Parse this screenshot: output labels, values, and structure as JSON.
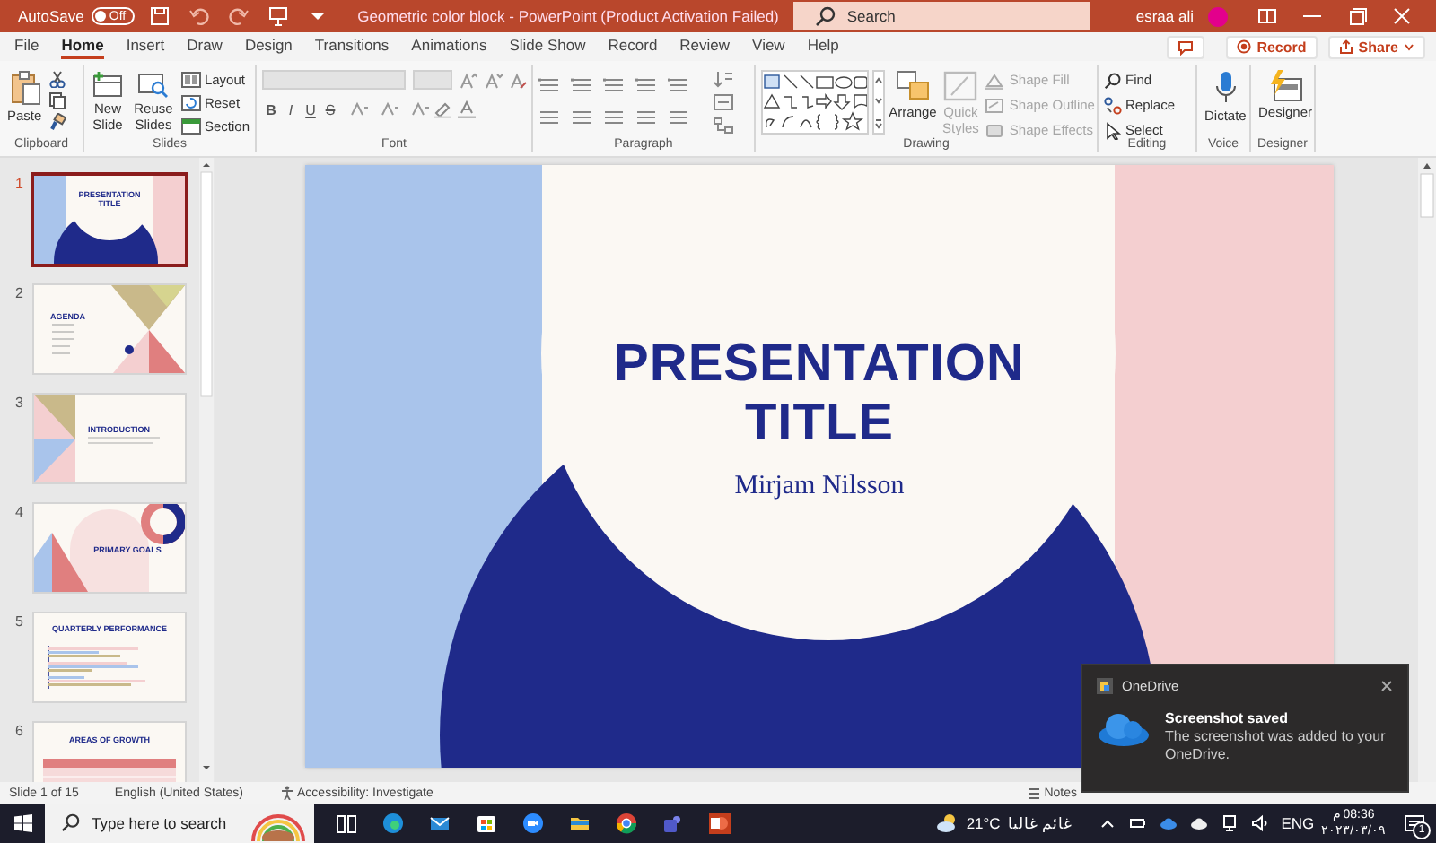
{
  "title_bar": {
    "autosave_label": "AutoSave",
    "autosave_toggle": {
      "label": "Off",
      "on": false
    },
    "document_title": "Geometric color block  -  PowerPoint (Product Activation Failed)",
    "search": {
      "placeholder": "Search"
    },
    "user_name": "esraa ali"
  },
  "tabs": [
    {
      "label": "File",
      "selected": false
    },
    {
      "label": "Home",
      "selected": true
    },
    {
      "label": "Insert",
      "selected": false
    },
    {
      "label": "Draw",
      "selected": false
    },
    {
      "label": "Design",
      "selected": false
    },
    {
      "label": "Transitions",
      "selected": false
    },
    {
      "label": "Animations",
      "selected": false
    },
    {
      "label": "Slide Show",
      "selected": false
    },
    {
      "label": "Record",
      "selected": false
    },
    {
      "label": "Review",
      "selected": false
    },
    {
      "label": "View",
      "selected": false
    },
    {
      "label": "Help",
      "selected": false
    }
  ],
  "tab_bar_actions": {
    "record": "Record",
    "share": "Share"
  },
  "ribbon": {
    "clipboard": {
      "label": "Clipboard",
      "paste": "Paste"
    },
    "slides": {
      "label": "Slides",
      "new_slide": "New Slide",
      "reuse_slides": "Reuse Slides",
      "layout": "Layout",
      "reset": "Reset",
      "section": "Section"
    },
    "font": {
      "label": "Font",
      "format_buttons": [
        "B",
        "I",
        "U",
        "S"
      ]
    },
    "paragraph": {
      "label": "Paragraph"
    },
    "drawing": {
      "label": "Drawing",
      "controls": [
        {
          "kind": "large",
          "label": "Arrange",
          "disabled": false
        },
        {
          "kind": "large",
          "label": "Quick Styles",
          "disabled": true
        },
        {
          "kind": "small",
          "label": "Shape Fill",
          "disabled": true
        },
        {
          "kind": "small",
          "label": "Shape Outline",
          "disabled": true
        },
        {
          "kind": "small",
          "label": "Shape Effects",
          "disabled": true
        }
      ]
    },
    "editing": {
      "label": "Editing",
      "find": "Find",
      "replace": "Replace",
      "select": "Select"
    },
    "voice": {
      "label": "Voice",
      "dictate": "Dictate"
    },
    "designer": {
      "label": "Designer",
      "designer": "Designer"
    }
  },
  "slide_thumbnails": [
    {
      "number": "1",
      "title": "PRESENTATION TITLE",
      "kind": "title",
      "selected": true
    },
    {
      "number": "2",
      "title": "AGENDA",
      "kind": "agenda",
      "selected": false
    },
    {
      "number": "3",
      "title": "INTRODUCTION",
      "kind": "section",
      "selected": false
    },
    {
      "number": "4",
      "title": "PRIMARY GOALS",
      "kind": "goals",
      "selected": false
    },
    {
      "number": "5",
      "title": "QUARTERLY PERFORMANCE",
      "kind": "chart",
      "selected": false
    },
    {
      "number": "6",
      "title": "AREAS OF GROWTH",
      "kind": "table",
      "selected": false
    }
  ],
  "slide": {
    "title": "PRESENTATION TITLE",
    "subtitle": "Mirjam Nilsson"
  },
  "status_bar": {
    "slide_position": "Slide 1 of 15",
    "language": "English (United States)",
    "accessibility": "Accessibility: Investigate",
    "notes": "Notes"
  },
  "taskbar": {
    "search": {
      "placeholder": "Type here to search"
    },
    "temperature": "21°C",
    "weather": "غائم غالبا",
    "language": "ENG",
    "time": "08:36 م",
    "date": "٢٠٢٣/٠٣/٠٩",
    "notification_count": "1"
  },
  "notification": {
    "app": "OneDrive",
    "title": "Screenshot saved",
    "message": "The screenshot was added to your OneDrive."
  }
}
